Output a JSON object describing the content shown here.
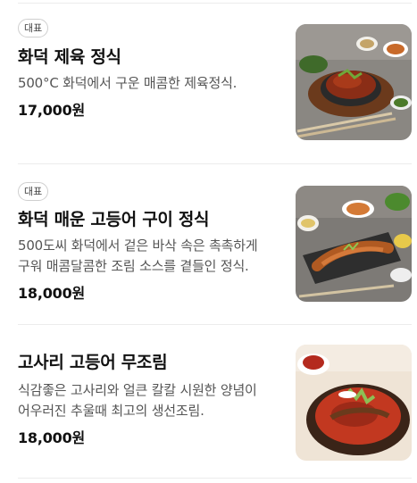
{
  "menu": {
    "items": [
      {
        "badge": "대표",
        "name": "화덕 제육 정식",
        "description": "500°C 화덕에서 구운 매콤한 제육정식.",
        "price": "17,000원"
      },
      {
        "badge": "대표",
        "name": "화덕 매운 고등어 구이 정식",
        "description": "500도씨 화덕에서 겉은 바삭 속은 촉촉하게 구워 매콤달콤한 조림 소스를 곁들인 정식.",
        "price": "18,000원"
      },
      {
        "name": "고사리 고등어 무조림",
        "description": "식감좋은 고사리와 얼큰 칼칼 시원한 양념이 어우러진 추울때 최고의 생선조림.",
        "price": "18,000원"
      }
    ]
  },
  "colors": {
    "divider": "#ececec",
    "badge_border": "#cfcfcf",
    "description": "#555555",
    "price": "#111111"
  }
}
